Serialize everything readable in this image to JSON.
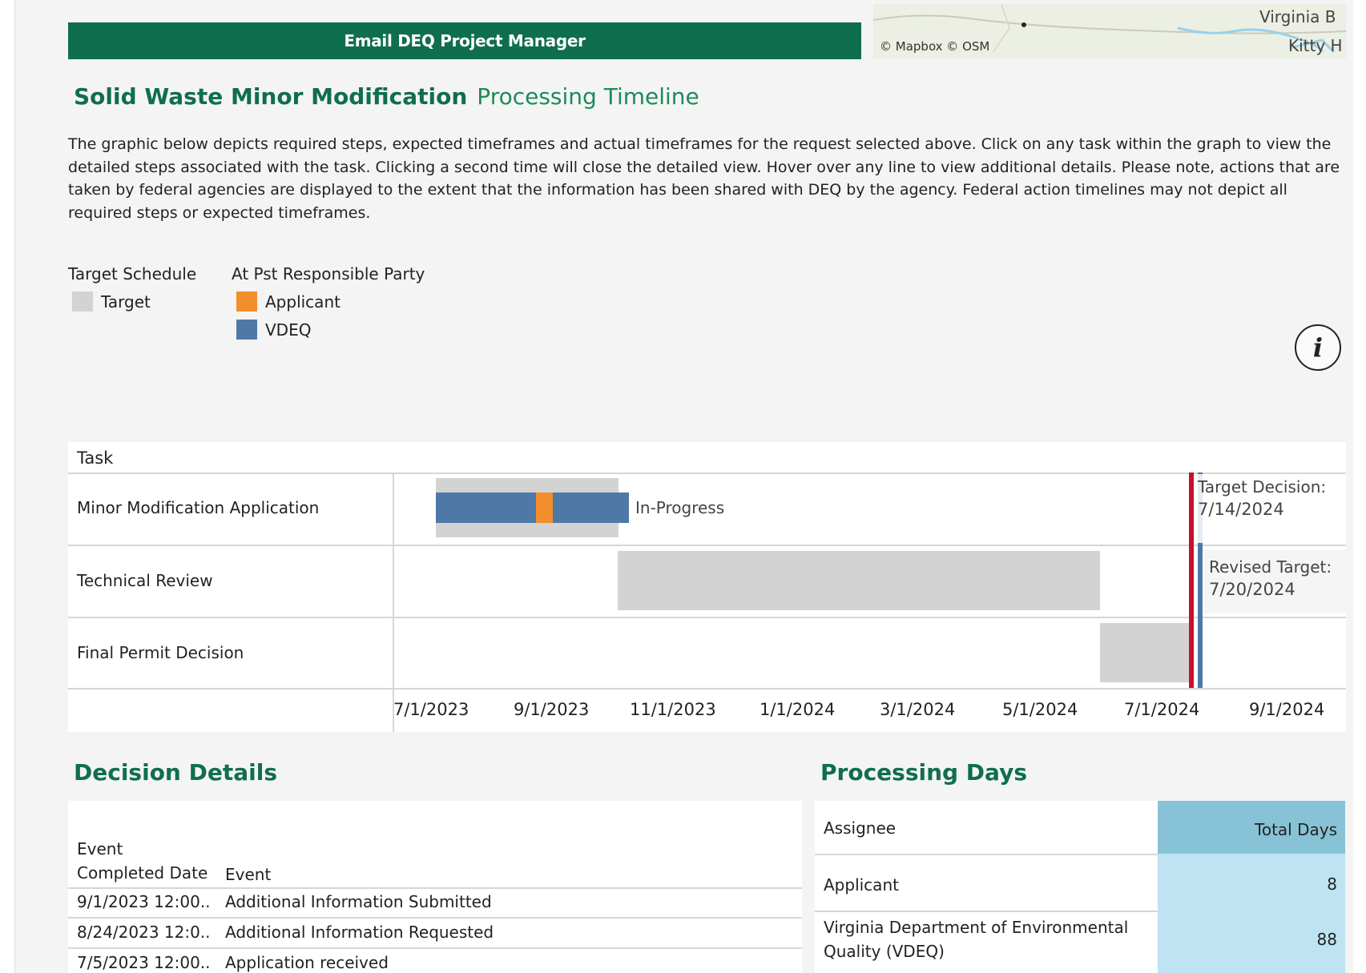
{
  "header": {
    "email_button": "Email DEQ Project Manager",
    "map_copyright": "© Mapbox  © OSM",
    "map_labels": [
      "Virginia B",
      "Kitty H"
    ]
  },
  "title": {
    "main": "Solid Waste Minor Modification",
    "sub": "Processing Timeline"
  },
  "description": "The graphic below depicts required steps, expected timeframes and actual timeframes for the request selected above. Click on any task within the graph to view the detailed steps associated with the task. Clicking a second time will close the detailed view. Hover over any line to view additional details.  Please note, actions that are taken by federal agencies are displayed to the extent that the information has been shared with DEQ by the agency. Federal action timelines may not depict all required steps or expected timeframes.",
  "legend": {
    "target_schedule_heading": "Target Schedule",
    "responsible_party_heading": "At Pst Responsible Party",
    "target_label": "Target",
    "applicant_label": "Applicant",
    "vdeq_label": "VDEQ",
    "colors": {
      "target": "#d3d3d3",
      "applicant": "#f28e2b",
      "vdeq": "#4e79a7",
      "target_decision_line": "#c8102e",
      "revised_target_line": "#4e79a7"
    }
  },
  "gantt": {
    "task_header": "Task",
    "tasks": [
      "Minor Modification Application",
      "Technical Review",
      "Final Permit Decision"
    ],
    "status_label": "In-Progress",
    "target_decision_label": "Target Decision:",
    "target_decision_date": "7/14/2024",
    "revised_target_label": "Revised Target:",
    "revised_target_date": "7/20/2024",
    "ticks": [
      "7/1/2023",
      "9/1/2023",
      "11/1/2023",
      "1/1/2024",
      "3/1/2024",
      "5/1/2024",
      "7/1/2024",
      "9/1/2024"
    ]
  },
  "decision_details": {
    "title": "Decision Details",
    "col_date_line1": "Event",
    "col_date_line2": "Completed Date",
    "col_event": "Event",
    "rows": [
      {
        "date": "9/1/2023 12:00..",
        "event": "Additional Information Submitted"
      },
      {
        "date": "8/24/2023 12:0..",
        "event": "Additional Information Requested"
      },
      {
        "date": "7/5/2023 12:00..",
        "event": "Application received"
      }
    ]
  },
  "processing_days": {
    "title": "Processing Days",
    "col_assignee": "Assignee",
    "col_total": "Total Days",
    "rows": [
      {
        "assignee": "Applicant",
        "days": "8"
      },
      {
        "assignee_line1": "Virginia Department of Environmental",
        "assignee_line2": "Quality (VDEQ)",
        "days": "88"
      }
    ]
  }
}
